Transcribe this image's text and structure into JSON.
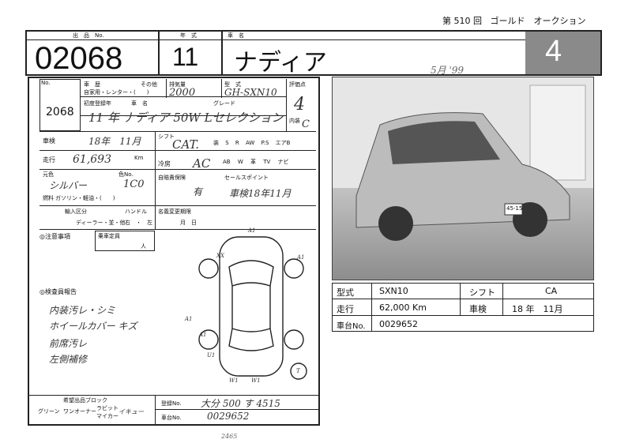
{
  "header": {
    "round_prefix": "第",
    "round_number": "510",
    "round_suffix": "回",
    "auction_name": "ゴールド　オークション"
  },
  "top_row": {
    "lot_label": "出　品　No.",
    "lot_number": "02068",
    "year_label": "年　式",
    "year": "11",
    "model_label": "車　名",
    "model": "ナディア",
    "grade_big": "4",
    "photo_date": "5月 '99"
  },
  "sheet": {
    "no_label": "No.",
    "no_value": "2068",
    "owner_labels": [
      "車　歴",
      "その他",
      "自家用・レンター・(　　)"
    ],
    "engine_label": "排気量",
    "engine_value": "2000",
    "model_code_label": "型　式",
    "model_code_value": "GH-SXN10",
    "score_label": "評価点",
    "score_value": "4",
    "reg_label": "初度登録年",
    "car_name_label": "車　名",
    "grade_label": "グレード",
    "reg_hand": "11 年 ナディア 50W Lセレクション",
    "interior_label": "内装",
    "interior_value": "C",
    "inspection_label": "車検",
    "inspection_value": "18年　11月",
    "shift_label": "シフト",
    "shift_value": "CAT.",
    "equip_labels": [
      "装",
      "S",
      "R",
      "AW",
      "P.S",
      "エアB"
    ],
    "mileage_label": "走行",
    "mileage_value": "61,693",
    "mileage_unit": "Km",
    "ac_label": "冷房",
    "ac_value": "AC",
    "equip2_labels": [
      "AB",
      "W",
      "革",
      "TV",
      "ナビ"
    ],
    "color_label": "元色",
    "color_value": "シルバー",
    "color_code_label": "色No.",
    "color_code_value": "1C0",
    "fuel_label": "燃料",
    "fuel_value": "ガソリン・軽油・(　　)",
    "recycle_label": "自賠責保険",
    "recycle_value": "有",
    "sales_point_label": "セールスポイント",
    "sales_point_value": "車検18年11月",
    "import_label": "輸入区分",
    "dealer_label": "ディーラー・並・他",
    "handle_label": "ハンドル",
    "handle_value": "右　・　左",
    "name_change_label": "名義変更期限",
    "name_change_value": "月　日",
    "notes_label": "◎注意事項",
    "capacity_label": "乗車定員",
    "capacity_unit": "人",
    "inspector_label": "◎検査員報告",
    "inspector_notes": [
      "内装汚レ・シミ",
      "ホイールカバー キズ",
      "前席汚レ",
      "左側補修"
    ],
    "vin_label": "車台No.",
    "vin_value": "0029652",
    "reg_no_label": "登録No.",
    "reg_no_value": "大分 500 す 4515",
    "bottom_labels": [
      "希望出品ブロック",
      "グリーン",
      "ワンオーナー",
      "ラビット",
      "マイカー",
      "イキュー"
    ],
    "diagram_marks": [
      "A1",
      "A1",
      "XX",
      "A1",
      "A1",
      "W1",
      "W1",
      "U1",
      "T"
    ],
    "footer_number": "2465"
  },
  "summary": {
    "rows": [
      {
        "label": "型式",
        "value": "SXN10",
        "label2": "シフト",
        "value2": "CA"
      },
      {
        "label": "走行",
        "value": "62,000 Km",
        "label2": "車検",
        "value2": "18 年　11月"
      },
      {
        "label": "車台No.",
        "value": "0029652",
        "label2": "",
        "value2": ""
      }
    ]
  },
  "photo": {
    "plate": "45-15"
  }
}
